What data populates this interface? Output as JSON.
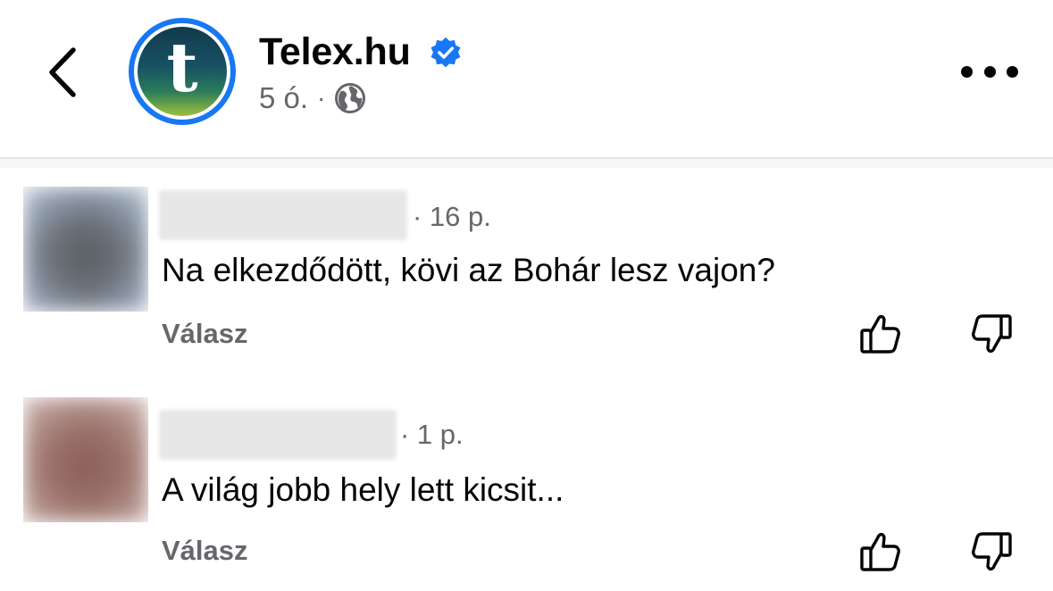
{
  "header": {
    "back_icon": "chevron-left-icon",
    "page_name": "Telex.hu",
    "avatar_letter": "t",
    "verified_icon": "verified-badge-icon",
    "verified_color": "#1877f2",
    "time": "5 ó.",
    "separator": "·",
    "audience_icon": "globe-icon",
    "more_icon": "more-horizontal-icon"
  },
  "comments": [
    {
      "time": "· 16 p.",
      "text": "Na elkezdődött, kövi az Bohár lesz vajon?",
      "reply_label": "Válasz",
      "like_icon": "thumbs-up-icon",
      "dislike_icon": "thumbs-down-icon"
    },
    {
      "time": "· 1 p.",
      "text": "A világ jobb hely lett kicsit...",
      "reply_label": "Válasz",
      "like_icon": "thumbs-up-icon",
      "dislike_icon": "thumbs-down-icon"
    }
  ],
  "colors": {
    "secondary_text": "#65676b",
    "primary_text": "#050505",
    "accent": "#1877f2"
  }
}
